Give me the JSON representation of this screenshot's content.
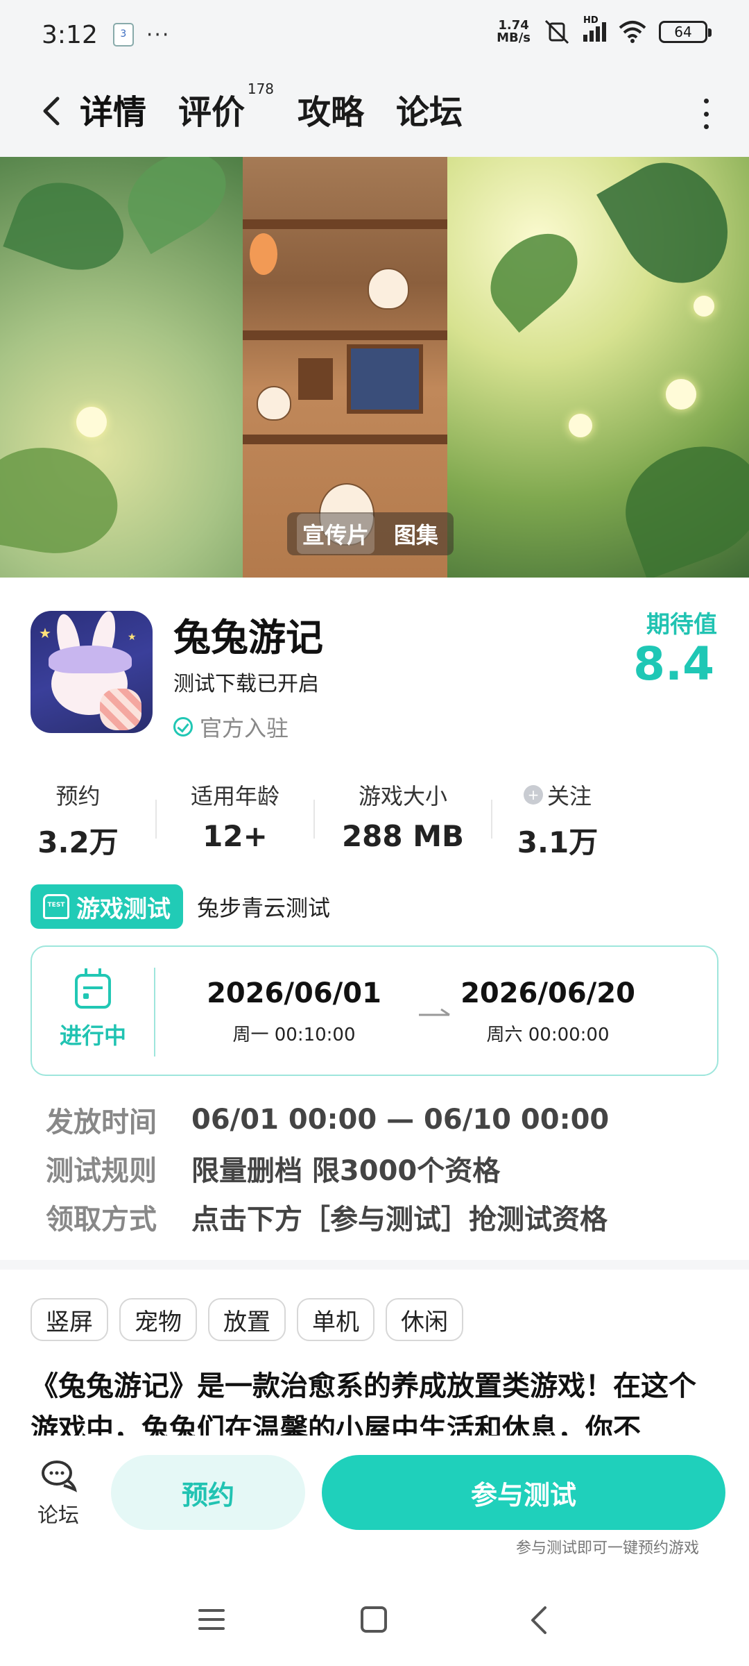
{
  "status_bar": {
    "time": "3:12",
    "notif_badge": "3",
    "dots": "···",
    "net_speed_top": "1.74",
    "net_speed_bottom": "MB/s",
    "signal_label": "HD",
    "battery": "64"
  },
  "nav": {
    "tabs": [
      {
        "label": "详情",
        "active": true
      },
      {
        "label": "评价",
        "count": "178"
      },
      {
        "label": "攻略"
      },
      {
        "label": "论坛"
      }
    ]
  },
  "banner": {
    "labels": [
      "宣传片",
      "图集"
    ]
  },
  "game": {
    "title": "兔兔游记",
    "subtitle": "测试下载已开启",
    "official": "官方入驻",
    "expect_label": "期待值",
    "expect_value": "8.4",
    "stats": [
      {
        "label": "预约",
        "value": "3.2万"
      },
      {
        "label": "适用年龄",
        "value": "12+"
      },
      {
        "label": "游戏大小",
        "value": "288 MB"
      },
      {
        "label": "关注",
        "value": "3.1万"
      }
    ]
  },
  "test": {
    "tag": "游戏测试",
    "tag_icon_text": "TEST",
    "name": "兔步青云测试",
    "status": "进行中",
    "start_date": "2026/06/01",
    "start_sub": "周一  00:10:00",
    "end_date": "2026/06/20",
    "end_sub": "周六  00:00:00",
    "info": [
      {
        "key": "发放时间",
        "value": "06/01 00:00 — 06/10 00:00"
      },
      {
        "key": "测试规则",
        "value": "限量删档 限3000个资格"
      },
      {
        "key": "领取方式",
        "value": "点击下方［参与测试］抢测试资格"
      }
    ]
  },
  "tags": [
    "竖屏",
    "宠物",
    "放置",
    "单机",
    "休闲"
  ],
  "description": "《兔兔游记》是一款治愈系的养成放置类游戏！在这个游戏中，兔兔们在温馨的小屋中生活和休息，你不",
  "actions": {
    "forum_label": "论坛",
    "reserve_label": "预约",
    "join_label": "参与测试",
    "join_hint": "参与测试即可一键预约游戏"
  },
  "colors": {
    "accent": "#1fd0bb",
    "accent_light": "#e5f8f6"
  }
}
